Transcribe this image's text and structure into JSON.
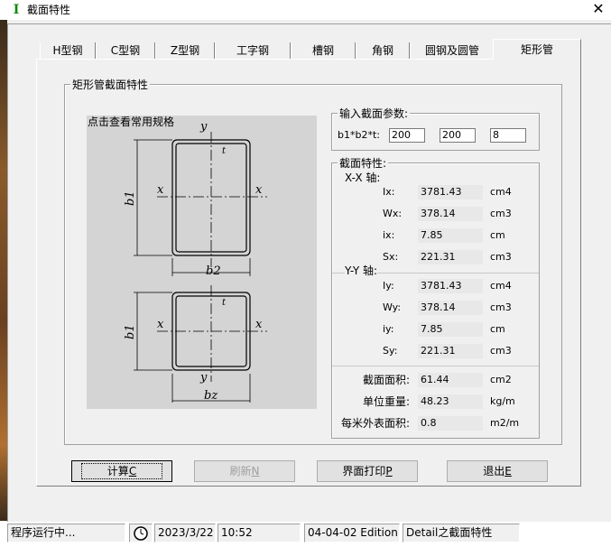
{
  "window": {
    "title": "截面特性",
    "close_glyph": "✕",
    "app_icon_glyph": "I"
  },
  "tabs": [
    "H型钢",
    "C型钢",
    "Z型钢",
    "工字钢",
    "槽钢",
    "角钢",
    "圆钢及圆管",
    "矩形管"
  ],
  "group": {
    "title": "矩形管截面特性"
  },
  "drawing": {
    "hint": "点击查看常用规格"
  },
  "input": {
    "title": "输入截面参数:",
    "label": "b1*b2*t:",
    "b1": "200",
    "b2": "200",
    "t": "8"
  },
  "props": {
    "title": "截面特性:",
    "xx_label": "X-X 轴:",
    "yy_label": "Y-Y 轴:",
    "xx": [
      {
        "name": "Ix:",
        "value": "3781.43",
        "unit": "cm4"
      },
      {
        "name": "Wx:",
        "value": "378.14",
        "unit": "cm3"
      },
      {
        "name": "ix:",
        "value": "7.85",
        "unit": "cm"
      },
      {
        "name": "Sx:",
        "value": "221.31",
        "unit": "cm3"
      }
    ],
    "yy": [
      {
        "name": "Iy:",
        "value": "3781.43",
        "unit": "cm4"
      },
      {
        "name": "Wy:",
        "value": "378.14",
        "unit": "cm3"
      },
      {
        "name": "iy:",
        "value": "7.85",
        "unit": "cm"
      },
      {
        "name": "Sy:",
        "value": "221.31",
        "unit": "cm3"
      }
    ],
    "general": [
      {
        "name": "截面面积:",
        "value": "61.44",
        "unit": "cm2"
      },
      {
        "name": "单位重量:",
        "value": "48.23",
        "unit": "kg/m"
      },
      {
        "name": "每米外表面积:",
        "value": "0.8",
        "unit": "m2/m"
      }
    ]
  },
  "buttons": {
    "calc": {
      "text": "计算",
      "key": "C"
    },
    "refresh": {
      "text": "刷新",
      "key": "N"
    },
    "print": {
      "text": "界面打印",
      "key": "P"
    },
    "exit": {
      "text": "退出",
      "key": "E"
    }
  },
  "status": {
    "state": "程序运行中...",
    "date": "2023/3/22",
    "time": "10:52",
    "edition": "04-04-02 Edition",
    "detail": "Detail之截面特性"
  },
  "colors": {
    "field_bg": "#e8e8e8",
    "drawing_bg": "#d4d4d4",
    "icon_green": "#0a8a0a"
  }
}
